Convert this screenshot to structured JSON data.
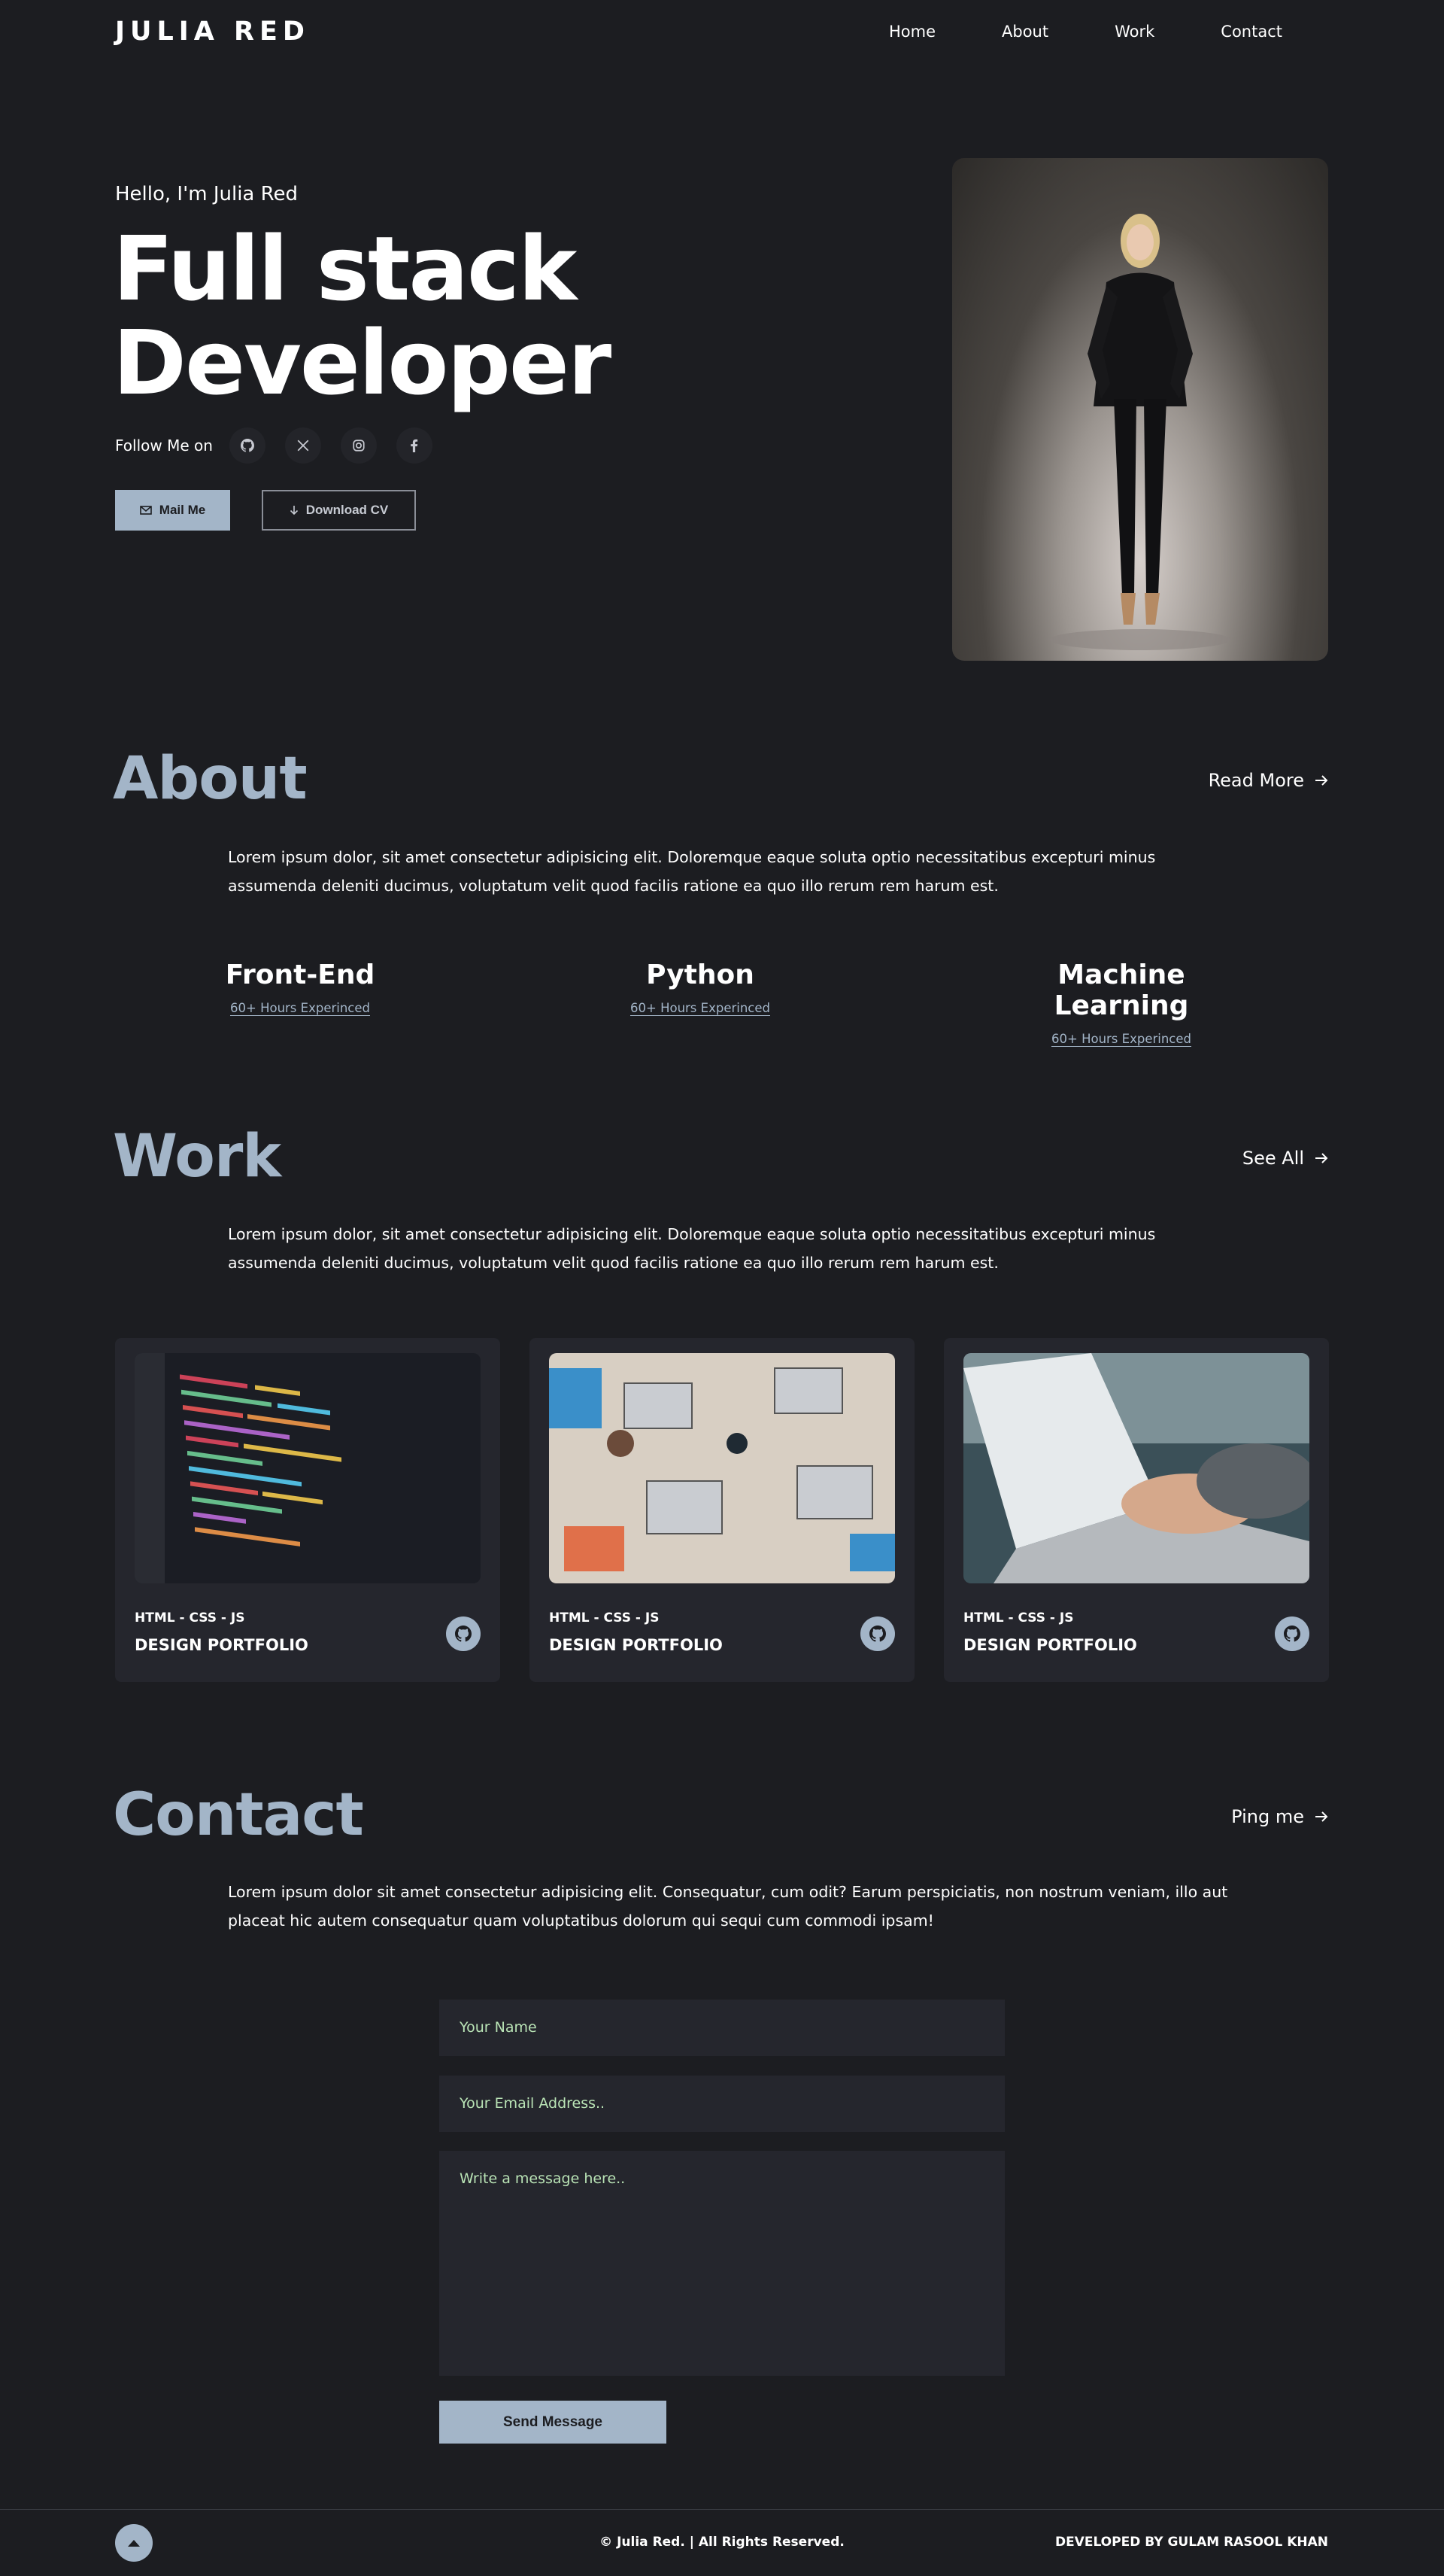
{
  "nav": {
    "logo": "JULIA RED",
    "links": [
      "Home",
      "About",
      "Work",
      "Contact"
    ]
  },
  "hero": {
    "greeting": "Hello, I'm Julia Red",
    "headline_line1": "Full stack",
    "headline_line2": "Developer",
    "follow_label": "Follow Me on",
    "socials": [
      "github-icon",
      "x-icon",
      "instagram-icon",
      "facebook-icon"
    ],
    "mail_label": "Mail Me",
    "cv_label": "Download CV"
  },
  "about": {
    "title": "About",
    "link": "Read More",
    "text": "Lorem ipsum dolor, sit amet consectetur adipisicing elit. Doloremque eaque soluta optio necessitatibus excepturi minus assumenda deleniti ducimus, voluptatum velit quod facilis ratione ea quo illo rerum rem harum est.",
    "skills": [
      {
        "name": "Front-End",
        "sub": "60+ Hours Experinced"
      },
      {
        "name": "Python",
        "sub": "60+ Hours Experinced"
      },
      {
        "name": "Machine Learning",
        "sub": "60+ Hours Experinced"
      }
    ]
  },
  "work": {
    "title": "Work",
    "link": "See All",
    "text": "Lorem ipsum dolor, sit amet consectetur adipisicing elit. Doloremque eaque soluta optio necessitatibus excepturi minus assumenda deleniti ducimus, voluptatum velit quod facilis ratione ea quo illo rerum rem harum est.",
    "projects": [
      {
        "tech": "HTML - CSS - JS",
        "title": "DESIGN PORTFOLIO"
      },
      {
        "tech": "HTML - CSS - JS",
        "title": "DESIGN PORTFOLIO"
      },
      {
        "tech": "HTML - CSS - JS",
        "title": "DESIGN PORTFOLIO"
      }
    ]
  },
  "contact": {
    "title": "Contact",
    "link": "Ping me",
    "text": "Lorem ipsum dolor sit amet consectetur adipisicing elit. Consequatur, cum odit? Earum perspiciatis, non nostrum veniam, illo aut placeat hic autem consequatur quam voluptatibus dolorum qui sequi cum commodi ipsam!",
    "name_placeholder": "Your Name",
    "email_placeholder": "Your Email Address..",
    "message_placeholder": "Write a message here..",
    "send_label": "Send Message"
  },
  "footer": {
    "copyright": "© Julia Red. | All Rights Reserved.",
    "credit": "DEVELOPED BY GULAM RASOOL KHAN"
  },
  "colors": {
    "background": "#1c1d21",
    "accent": "#a3b5c8",
    "card": "#25262d",
    "placeholder": "#b9e3b5"
  }
}
